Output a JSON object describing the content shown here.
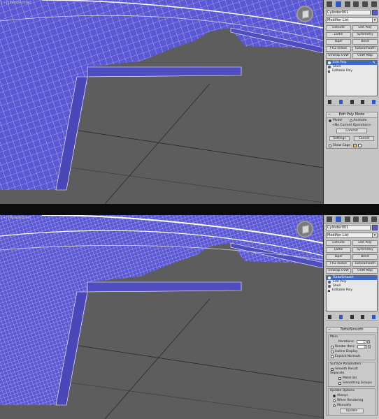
{
  "top": {
    "viewport_label": "[+] [Perspective]",
    "object_name": "Cylinder001",
    "modifier_list": "Modifier List",
    "modifier_buttons": [
      "Extrude",
      "Edit Poly",
      "Lathe",
      "Symmetry",
      "Taper",
      "Bend",
      "FFD 4x4x4",
      "TurboSmooth",
      "Unwrap UVW",
      "UVW Map"
    ],
    "stack": [
      {
        "label": "Edit Poly",
        "selected": true
      },
      {
        "label": "Shell",
        "selected": false
      },
      {
        "label": "Editable Poly",
        "selected": false
      }
    ],
    "rollout": {
      "title": "Edit Poly Mode",
      "mode_model": "Model",
      "mode_animate": "Animate",
      "current_op": "<No Current Operation>",
      "commit": "Commit",
      "settings": "Settings",
      "cancel": "Cancel",
      "show_cage": "Show Cage"
    }
  },
  "bottom": {
    "viewport_label": "[+] [Perspective]",
    "object_name": "Cylinder001",
    "modifier_list": "Modifier List",
    "modifier_buttons": [
      "Extrude",
      "Edit Poly",
      "Lathe",
      "Symmetry",
      "Taper",
      "Bend",
      "FFD 4x4x4",
      "TurboSmooth",
      "Unwrap UVW",
      "UVW Map"
    ],
    "stack": [
      {
        "label": "TurboSmooth",
        "selected": true
      },
      {
        "label": "Edit Poly",
        "selected": false
      },
      {
        "label": "Shell",
        "selected": false
      },
      {
        "label": "Editable Poly",
        "selected": false
      }
    ],
    "rollout": {
      "title": "TurboSmooth",
      "main": "Main",
      "iterations": "Iterations:",
      "iterations_value": "1",
      "render_iters": "Render Iters:",
      "render_iters_value": "0",
      "isoline": "Isoline Display",
      "explicit": "Explicit Normals",
      "surface": "Surface Parameters",
      "smooth_result": "Smooth Result",
      "separate": "Separate",
      "materials": "Materials",
      "smoothing_groups": "Smoothing Groups",
      "update_options": "Update Options",
      "always": "Always",
      "when_rendering": "When Rendering",
      "manually": "Manually",
      "update": "Update"
    }
  },
  "colors": {
    "mesh_fill": "#5a58d4",
    "ground": "#5d5d5d",
    "panel_bg": "#c5c5c5",
    "selection_blue": "#3d6ccd"
  }
}
